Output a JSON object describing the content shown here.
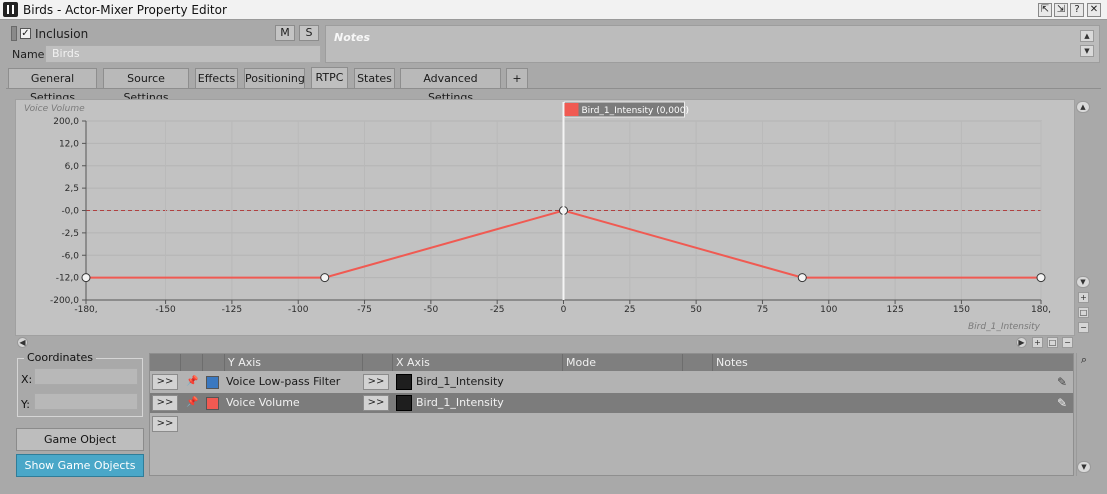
{
  "window": {
    "title": "Birds - Actor-Mixer Property Editor",
    "buttons": [
      "?",
      "?",
      "?",
      "✕"
    ]
  },
  "header": {
    "inclusion_label": "Inclusion",
    "inclusion_checked": true,
    "m_label": "M",
    "s_label": "S",
    "name_label": "Name",
    "name_value": "Birds",
    "notes_label": "Notes"
  },
  "tabs": [
    {
      "label": "General Settings",
      "active": false
    },
    {
      "label": "Source Settings",
      "active": false
    },
    {
      "label": "Effects",
      "active": false
    },
    {
      "label": "Positioning",
      "active": false
    },
    {
      "label": "RTPC",
      "active": true
    },
    {
      "label": "States",
      "active": false
    },
    {
      "label": "Advanced Settings",
      "active": false
    },
    {
      "label": "+",
      "active": false
    }
  ],
  "chart_data": {
    "type": "line",
    "ylabel": "Voice Volume",
    "xlabel": "Bird_1_Intensity",
    "y_tick_labels": [
      "200,0",
      "12,0",
      "6,0",
      "2,5",
      "-0,0",
      "-2,5",
      "-6,0",
      "-12,0",
      "-200,0"
    ],
    "x_tick_labels": [
      "-180,",
      "-150",
      "-125",
      "-100",
      "-75",
      "-50",
      "-25",
      "0",
      "25",
      "50",
      "75",
      "100",
      "125",
      "150",
      "180,"
    ],
    "x_ticks": [
      -180,
      -150,
      -125,
      -100,
      -75,
      -50,
      -25,
      0,
      25,
      50,
      75,
      100,
      125,
      150,
      180
    ],
    "xlim": [
      -180,
      180
    ],
    "cursor_label": "Bird_1_Intensity (0,000)",
    "cursor_x": 0,
    "series": [
      {
        "name": "Voice Volume",
        "color": "#f05a52",
        "points": [
          {
            "x": -180,
            "y": -12
          },
          {
            "x": -90,
            "y": -12
          },
          {
            "x": 0,
            "y": 0
          },
          {
            "x": 90,
            "y": -12
          },
          {
            "x": 180,
            "y": -12
          }
        ]
      }
    ]
  },
  "coordinates": {
    "title": "Coordinates",
    "x_label": "X:",
    "y_label": "Y:"
  },
  "buttons": {
    "game_object_explorer": "Game Object Explorer...",
    "show_game_objects": "Show Game Objects"
  },
  "rtpc_list": {
    "columns": [
      "Y Axis",
      "X Axis",
      "Mode",
      "Notes"
    ],
    "rows": [
      {
        "y_axis": "Voice Low-pass Filter",
        "x_axis": "Bird_1_Intensity",
        "color": "#3a78c0",
        "selected": false
      },
      {
        "y_axis": "Voice Volume",
        "x_axis": "Bird_1_Intensity",
        "color": "#f05a52",
        "selected": true
      }
    ],
    "arrow_label": ">>"
  }
}
